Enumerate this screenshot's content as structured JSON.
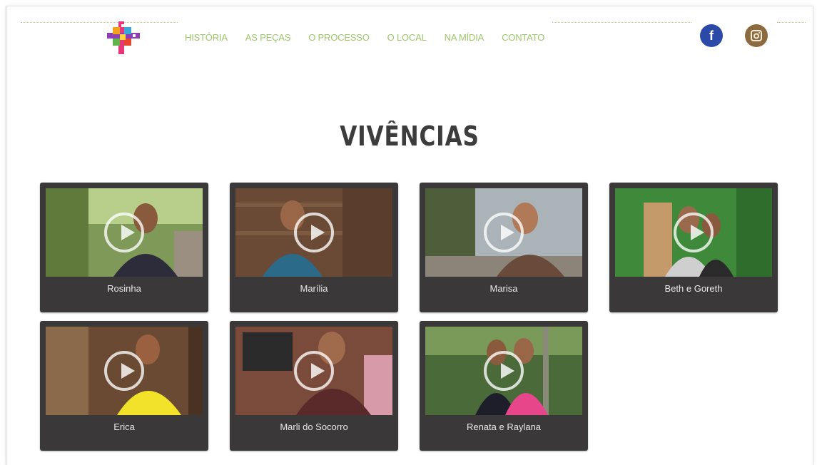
{
  "nav": {
    "items": [
      "HISTÓRIA",
      "AS PEÇAS",
      "O PROCESSO",
      "O LOCAL",
      "NA MÍDIA",
      "CONTATO"
    ]
  },
  "social": {
    "facebook": "f"
  },
  "page": {
    "title": "VIVÊNCIAS"
  },
  "videos": [
    {
      "name": "Rosinha"
    },
    {
      "name": "Marília"
    },
    {
      "name": "Marisa"
    },
    {
      "name": "Beth e Goreth"
    },
    {
      "name": "Erica"
    },
    {
      "name": "Marli do Socorro"
    },
    {
      "name": "Renata e Raylana"
    }
  ],
  "colors": {
    "nav": "#9cc76b",
    "card": "#3a3838",
    "title": "#3c3c3c",
    "facebook": "#2b4aa8",
    "instagram": "#8a6a3e"
  }
}
